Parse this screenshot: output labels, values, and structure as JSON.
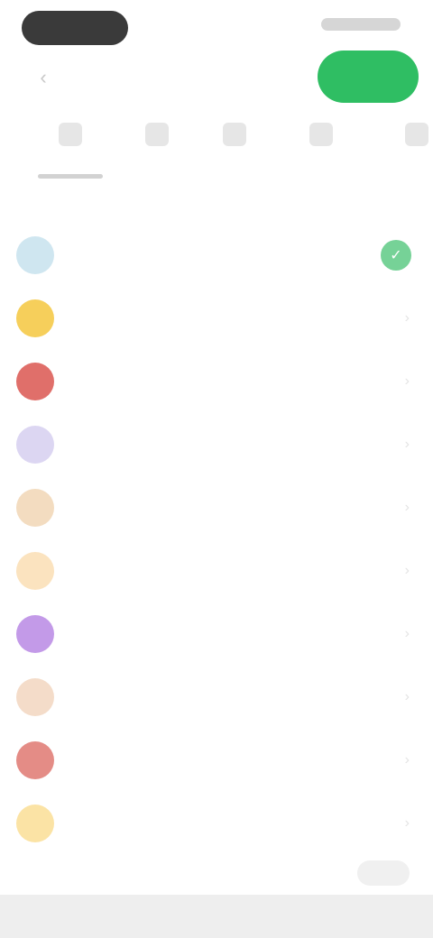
{
  "header": {
    "back_icon": "chevron-left-icon",
    "title": "",
    "primary_button": ""
  },
  "tabs": [
    {
      "label": "",
      "icon": "",
      "active": true
    },
    {
      "label": "",
      "icon": "",
      "active": false
    },
    {
      "label": "",
      "icon": "",
      "active": false
    },
    {
      "label": "",
      "icon": "",
      "active": false
    },
    {
      "label": "",
      "icon": "",
      "active": false
    }
  ],
  "hint": "",
  "list": {
    "rows": [
      {
        "label": "",
        "icon_color": "#cfe6f0",
        "selected": true
      },
      {
        "label": "",
        "icon_color": "#f6cf5b",
        "selected": false
      },
      {
        "label": "",
        "icon_color": "#e06f6a",
        "selected": false
      },
      {
        "label": "",
        "icon_color": "#dcd6f2",
        "selected": false
      },
      {
        "label": "",
        "icon_color": "#f3dcc0",
        "selected": false
      },
      {
        "label": "",
        "icon_color": "#fbe3bf",
        "selected": false
      },
      {
        "label": "",
        "icon_color": "#c39ae8",
        "selected": false
      },
      {
        "label": "",
        "icon_color": "#f4dcc9",
        "selected": false
      },
      {
        "label": "",
        "icon_color": "#e48c86",
        "selected": false
      },
      {
        "label": "",
        "icon_color": "#fbe3a5",
        "selected": false
      }
    ]
  },
  "footer": {
    "note": ""
  },
  "colors": {
    "accent": "#2fbe63",
    "check": "#54c77e"
  }
}
